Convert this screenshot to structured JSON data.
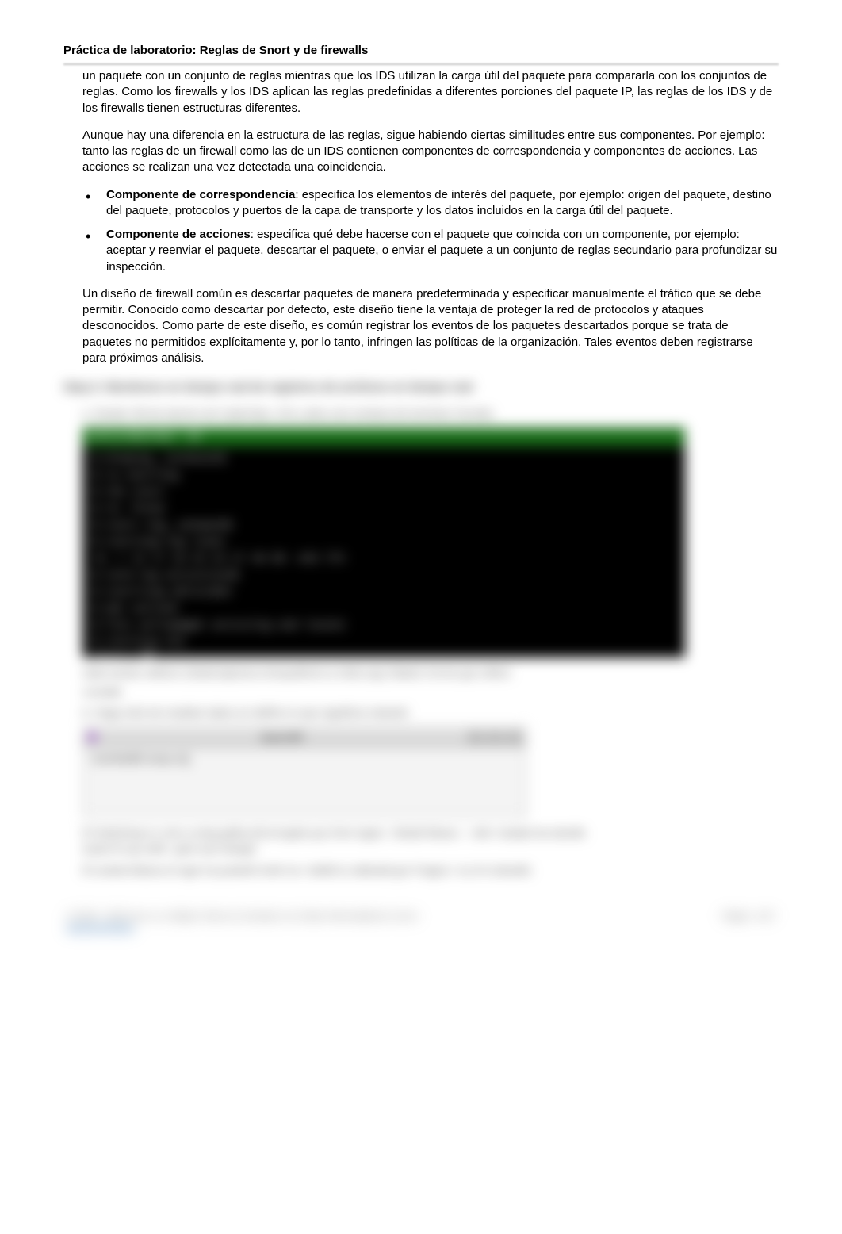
{
  "header": {
    "title": "Práctica de laboratorio: Reglas de Snort y de firewalls"
  },
  "p1": "un paquete con un conjunto de reglas mientras que los IDS utilizan la carga útil del paquete para compararla con los conjuntos de reglas. Como los firewalls y los IDS aplican las reglas predefinidas a diferentes porciones del paquete IP, las reglas de los IDS y de los firewalls tienen estructuras diferentes.",
  "p2": "Aunque hay una diferencia en la estructura de las reglas, sigue habiendo ciertas similitudes entre sus componentes. Por ejemplo: tanto las reglas de un firewall como las de un IDS contienen componentes de correspondencia y componentes de acciones. Las acciones se realizan una vez detectada una coincidencia.",
  "bullet1": {
    "label": "Componente de correspondencia",
    "text": ": especifica los elementos de interés del paquete, por ejemplo: origen del paquete, destino del paquete, protocolos y puertos de la capa de transporte y los datos incluidos en la carga útil del paquete."
  },
  "bullet2": {
    "label": "Componente de acciones",
    "text": ": especifica qué debe hacerse con el paquete que coincida con un componente, por ejemplo: aceptar y reenviar el paquete, descartar el paquete, o enviar el paquete a un conjunto de reglas secundario para profundizar su inspección."
  },
  "p3": "Un diseño de firewall común es descartar paquetes de manera predeterminada y especificar manualmente el tráfico que se debe permitir. Conocido como descartar por defecto, este diseño tiene la ventaja de proteger la red de protocolos y ataques desconocidos. Como parte de este diseño, es común registrar los eventos de los paquetes descartados porque se trata de paquetes no permitidos explícitamente y, por lo tanto, infringen las políticas de la organización. Tales eventos deben registrarse para próximos análisis.",
  "blurred": {
    "stepHeading": "Step 2: Monitoreo en tiempo real de registros de archivos en tiempo real",
    "subA": "a. Desde VM de alumno de CyberOps, Ctrl  y  abra una ventana de terminal.  Escriba",
    "terminalTitle": "analyst@secOps ~]$",
    "terminalLines": [
      "$ drawing__terminal$",
      "$ rw  snortlog",
      "$ the  start",
      "$ rm  -forms",
      "$ start.log__netmask$",
      "$ starting:log  lines",
      "rm -r  12  17  19  23  24 27  40  80 -443 lfn",
      "$ term-log  activities$",
      "$ startling  ablividen",
      "$ abc  outlook",
      "$ fini  yellowmgmt  activilog  and  locate",
      "$ startyng  231",
      "[done-x"
    ],
    "terminalFooterLine": "wide-tracker   all/dcor   (DataCapturea.ris/rquatford.cn.mlsb.org)          //dated:  let terr.gre.reflect",
    "terminalFooterLine2": "crunalte",
    "subB": "b. Haga click de  modelar   datos en delfins   lo que siguificar  estando",
    "windowTitle": "Snort IDT",
    "windowBody": "UserMadBt iswap m",
    "para4": "El Switching it  y min.a smig  gelba.toll.errogela quz forix togen.: Mutali Massu - .mbr+.teatain be derelle auste Ill cay stoft:: gest sure deogin",
    "para5": "El osobst Batura el ngar ha justarM meht na r deldit tu rakbodd gor fi lagos r va cH ordustils",
    "footerLeft": "© 2018 - 2018 raw a nr soflajes Tedca iss Sendans nce State Infenmatbul/a no brvc",
    "footerLink": "wwwnerophobe.",
    "footerRight": "Pagbs.  I.d17"
  }
}
